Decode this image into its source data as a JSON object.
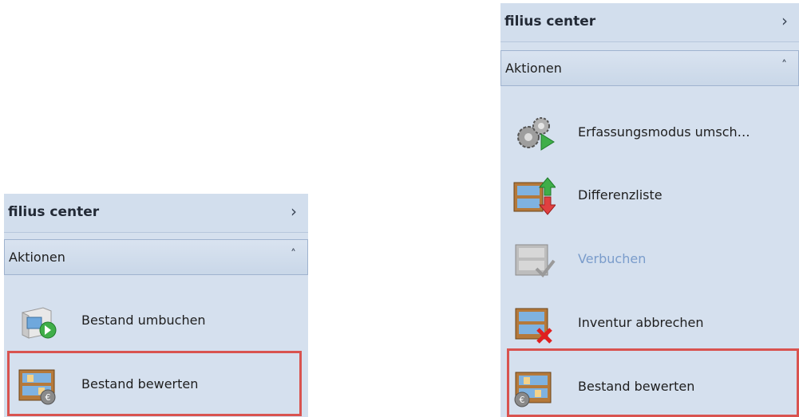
{
  "left_panel": {
    "title": "filius center",
    "section": "Aktionen",
    "items": [
      {
        "label": "Bestand umbuchen",
        "icon": "stock-transfer-icon"
      },
      {
        "label": "Bestand bewerten",
        "icon": "shelf-euro-icon"
      }
    ]
  },
  "right_panel": {
    "title": "filius center",
    "section": "Aktionen",
    "items": [
      {
        "label": "Erfassungsmodus umsch…",
        "icon": "gears-play-icon"
      },
      {
        "label": "Differenzliste",
        "icon": "shelf-updown-arrows-icon"
      },
      {
        "label": "Verbuchen",
        "icon": "shelf-check-icon",
        "disabled": true
      },
      {
        "label": "Inventur abbrechen",
        "icon": "shelf-cancel-icon"
      },
      {
        "label": "Bestand bewerten",
        "icon": "shelf-euro-icon"
      }
    ]
  },
  "icons": {
    "chevron_right": "›",
    "chevron_up": "˄"
  },
  "colors": {
    "highlight": "#d9534f",
    "disabled_text": "#7a9ccb",
    "panel_bg": "#d5e0ee"
  }
}
